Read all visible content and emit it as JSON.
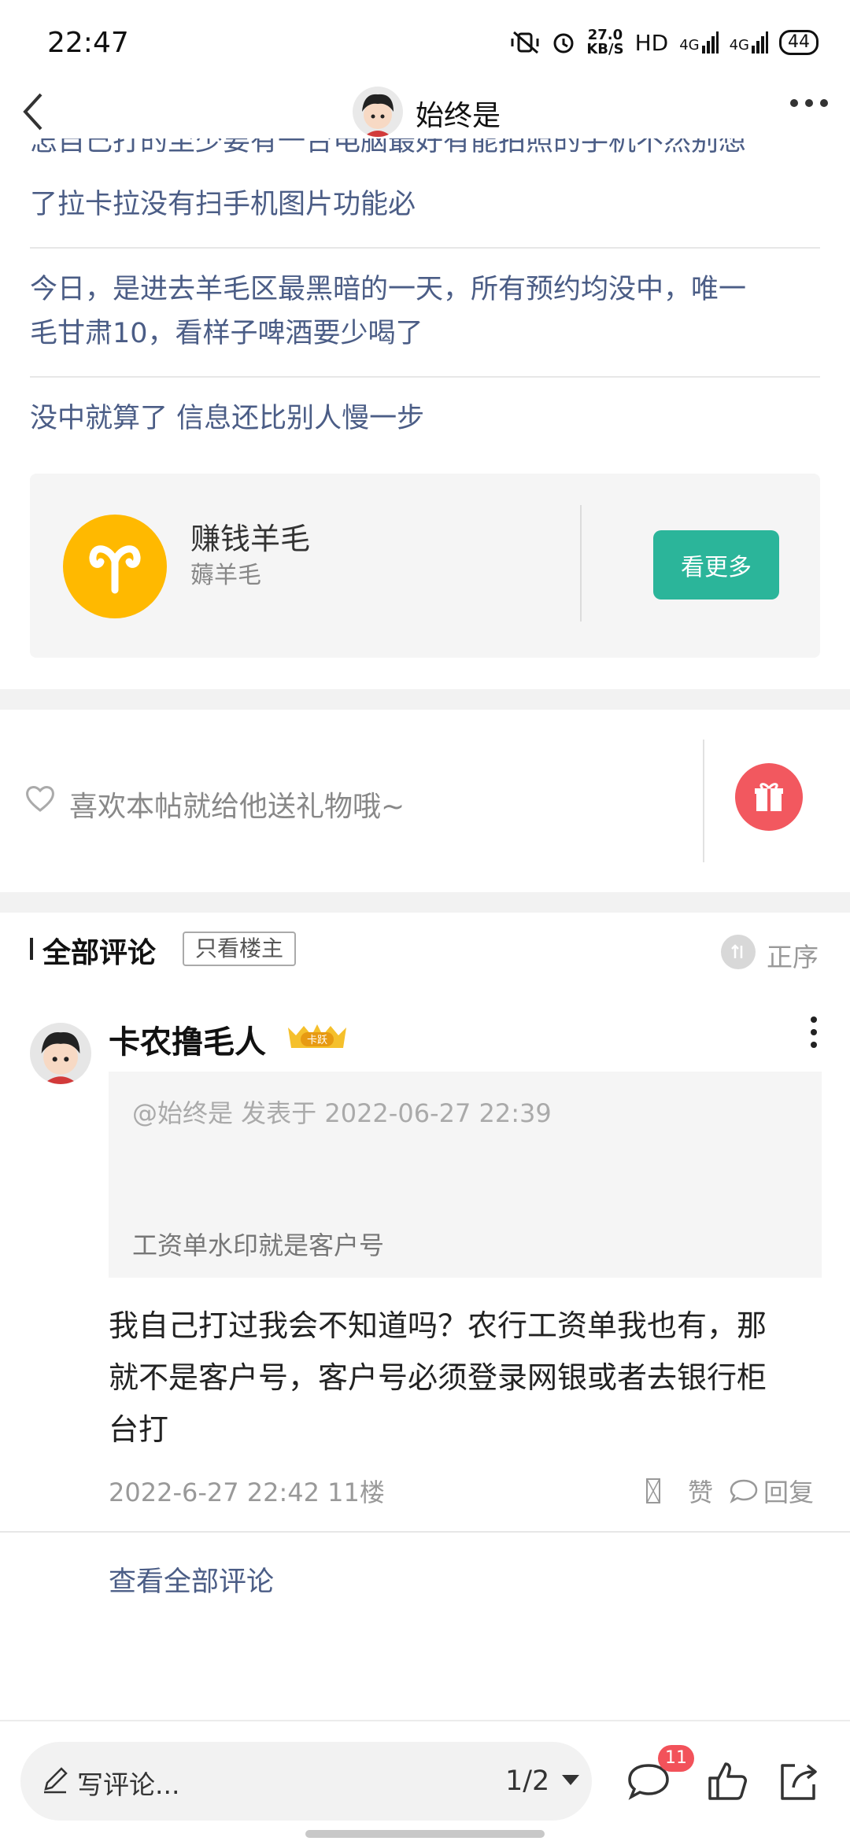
{
  "status_bar": {
    "time": "22:47",
    "speed_value": "27.0",
    "speed_unit": "KB/S",
    "hd": "HD",
    "net1": "4G",
    "net2": "4G",
    "battery": "44"
  },
  "header": {
    "back_icon": "chevron-left-icon",
    "author_name": "始终是",
    "more_icon": "more-dots-icon"
  },
  "related_posts": [
    {
      "text": "怎自己打的至少要有一台电脑最好有能拍照的手机不然别想"
    },
    {
      "text": "了拉卡拉没有扫手机图片功能必"
    },
    {
      "text": "今日，是进去羊毛区最黑暗的一天，所有预约均没中，唯一"
    },
    {
      "text": "毛甘肃10，看样子啤酒要少喝了"
    },
    {
      "text": "没中就算了 信息还比别人慢一步"
    }
  ],
  "group_card": {
    "name": "赚钱羊毛",
    "subtitle": "薅羊毛",
    "button_label": "看更多",
    "accent": "#2bb59a",
    "logo_color": "#ffb900"
  },
  "gift": {
    "prompt": "喜欢本帖就给他送礼物哦~",
    "button_color": "#f2585f"
  },
  "comments_header": {
    "title": "全部评论",
    "only_op": "只看楼主",
    "sort_label": "正序"
  },
  "comment": {
    "username": "卡农撸毛人",
    "badge": "卡跃",
    "quote_head": "@始终是 发表于 2022-06-27 22:39",
    "quote_body": "工资单水印就是客户号",
    "body_lines": [
      "我自己打过我会不知道吗？农行工资单我也有，那",
      "就不是客户号，客户号必须登录网银或者去银行柜",
      "台打"
    ],
    "meta": "2022-6-27 22:42  11楼",
    "like_label": "赞",
    "reply_label": "回复"
  },
  "view_all": "查看全部评论",
  "bottom_bar": {
    "write_placeholder": "写评论...",
    "page_indicator": "1/2",
    "comment_count": "11"
  }
}
